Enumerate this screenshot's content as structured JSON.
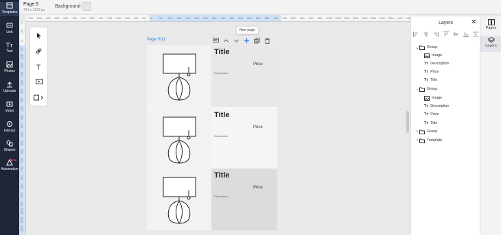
{
  "sidebar": {
    "items": [
      {
        "label": "Templates",
        "icon": "templates-icon"
      },
      {
        "label": "Link",
        "icon": "link-icon"
      },
      {
        "label": "Text",
        "icon": "text-icon"
      },
      {
        "label": "Photos",
        "icon": "photos-icon"
      },
      {
        "label": "Uploads",
        "icon": "uploads-icon"
      },
      {
        "label": "Video",
        "icon": "video-icon"
      },
      {
        "label": "Interact",
        "icon": "interact-icon"
      },
      {
        "label": "Shapes",
        "icon": "shapes-icon"
      },
      {
        "label": "Automation",
        "icon": "automation-icon",
        "badge": "BETA"
      }
    ]
  },
  "topbar": {
    "page_title": "Page 5",
    "page_size": "794 x 1123 px",
    "background_label": "Background"
  },
  "ruler": {
    "h_ticks": [
      "-700",
      "-650",
      "-600",
      "-550",
      "-500",
      "-450",
      "-400",
      "-350",
      "-300",
      "-250",
      "-200",
      "-150",
      "-100",
      "-50",
      "0",
      "50",
      "100",
      "150",
      "200",
      "250",
      "300",
      "350",
      "400",
      "450",
      "500",
      "550",
      "600",
      "650",
      "700",
      "750",
      "800",
      "850",
      "900",
      "950",
      "1000",
      "1050",
      "1100",
      "1150",
      "1200",
      "1250",
      "1300",
      "1350",
      "1400",
      "1450"
    ],
    "v_ticks": [
      "-100",
      "-50",
      "0",
      "50",
      "100",
      "150",
      "200",
      "250",
      "300",
      "350",
      "400",
      "450",
      "500",
      "550",
      "600",
      "650",
      "700",
      "750",
      "800",
      "850",
      "900",
      "950",
      "1000",
      "1050",
      "1100"
    ]
  },
  "canvas": {
    "page_label": "Page 5/11",
    "tooltip": "New page",
    "cards": [
      {
        "title": "Title",
        "price": "Price",
        "description": "Description"
      },
      {
        "title": "Title",
        "price": "Price",
        "description": "Description"
      },
      {
        "title": "Title",
        "price": "Price",
        "description": "Description"
      }
    ]
  },
  "layers": {
    "title": "Layers",
    "tree": [
      {
        "label": "Group",
        "type": "group",
        "expanded": true,
        "depth": 0
      },
      {
        "label": "Image",
        "type": "image",
        "depth": 1
      },
      {
        "label": "Description",
        "type": "text",
        "depth": 1
      },
      {
        "label": "Price",
        "type": "text",
        "depth": 1
      },
      {
        "label": "Title",
        "type": "text",
        "depth": 1
      },
      {
        "label": "Group",
        "type": "group",
        "expanded": true,
        "depth": 0
      },
      {
        "label": "Image",
        "type": "image",
        "depth": 1
      },
      {
        "label": "Description",
        "type": "text",
        "depth": 1
      },
      {
        "label": "Price",
        "type": "text",
        "depth": 1
      },
      {
        "label": "Title",
        "type": "text",
        "depth": 1
      },
      {
        "label": "Group",
        "type": "group",
        "expanded": false,
        "depth": 0
      },
      {
        "label": "Template",
        "type": "group",
        "expanded": false,
        "depth": 0
      }
    ]
  },
  "right_tabs": [
    {
      "label": "Pages",
      "icon": "pages-icon"
    },
    {
      "label": "Layers",
      "icon": "layers-icon",
      "active": true
    }
  ],
  "colors": {
    "sidebar": "#1f2638",
    "accent": "#2a7ae2",
    "highlight": "#cfe0f7"
  }
}
